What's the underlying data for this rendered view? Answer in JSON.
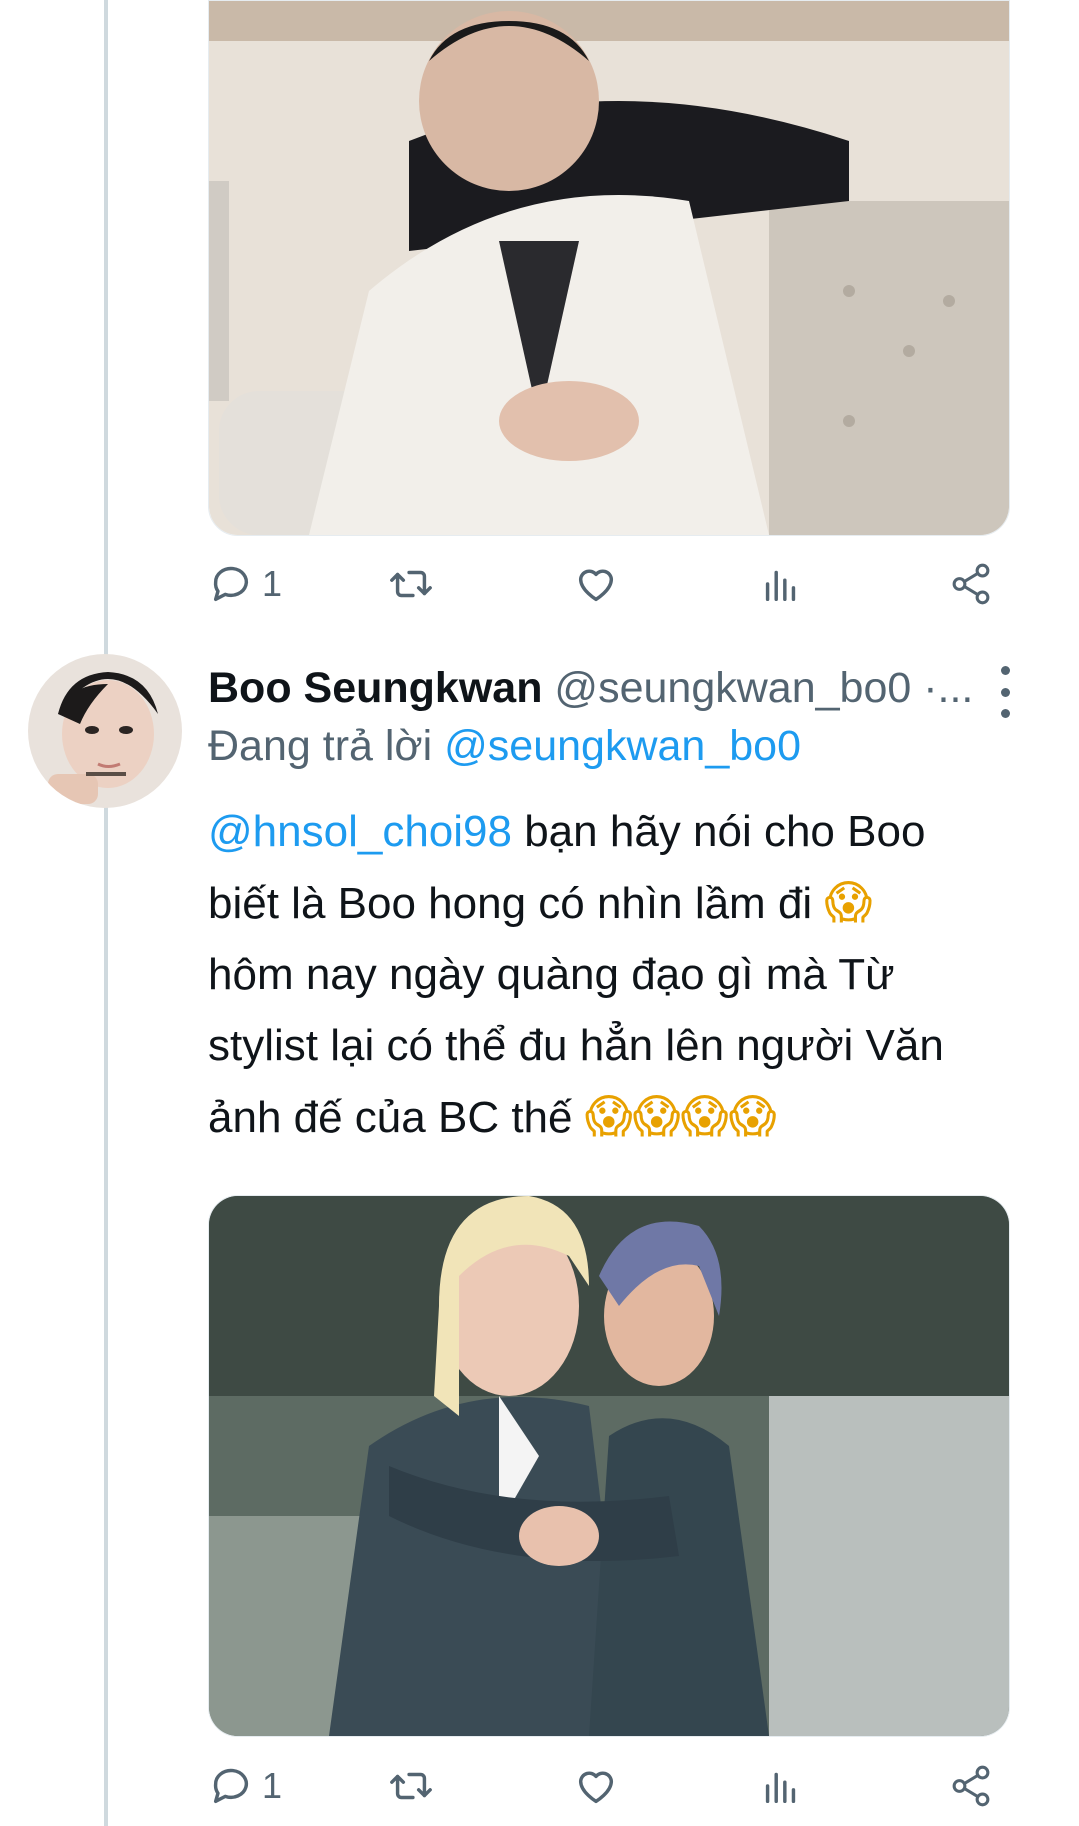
{
  "tweet_top": {
    "media_alt_icon": "photo",
    "actions": {
      "reply_count": "1",
      "retweet_count": "",
      "like_count": ""
    }
  },
  "tweet_reply": {
    "display_name": "Boo Seungkwan",
    "handle": "@seungkwan_bo0 ·...",
    "replying_prefix": "Đang trả lời",
    "replying_to": "@seungkwan_bo0",
    "text": {
      "mention": "@hnsol_choi98",
      "line1_rest": " bạn hãy nói cho Boo",
      "line2": "biết là Boo hong có nhìn lầm đi ",
      "line3": "hôm nay ngày quàng đạo gì mà Từ",
      "line4": "stylist lại có thể đu hẳn lên người Văn",
      "line5": "ảnh đế của BC thế ",
      "emoji_single": "😱",
      "emoji_multi": "😱😱😱😱"
    },
    "actions": {
      "reply_count": "1",
      "retweet_count": "",
      "like_count": ""
    }
  },
  "colors": {
    "link": "#1d9bf0",
    "secondary_text": "#536471",
    "primary_text": "#0f1419",
    "thread_line": "#cfd9de"
  }
}
